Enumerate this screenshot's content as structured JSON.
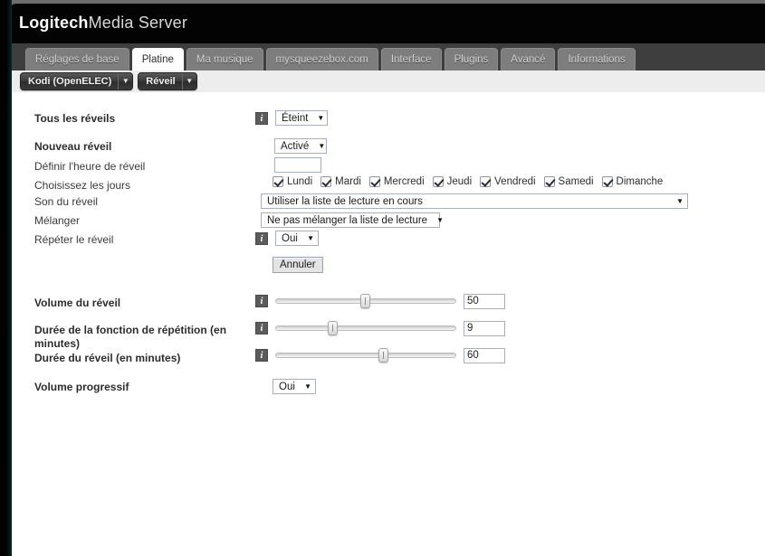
{
  "header": {
    "brand": "Logitech",
    "product": "Media Server"
  },
  "tabs": [
    {
      "label": "Réglages de base",
      "active": false
    },
    {
      "label": "Platine",
      "active": true
    },
    {
      "label": "Ma musique",
      "active": false
    },
    {
      "label": "mysqueezebox.com",
      "active": false
    },
    {
      "label": "Interface",
      "active": false
    },
    {
      "label": "Plugins",
      "active": false
    },
    {
      "label": "Avancé",
      "active": false
    },
    {
      "label": "Informations",
      "active": false
    }
  ],
  "toolbar": {
    "player_button": "Kodi (OpenELEC)",
    "section_button": "Réveil",
    "caret": "▼"
  },
  "form": {
    "all_alarms": {
      "label": "Tous les réveils",
      "info": "i",
      "value": "Éteint"
    },
    "new_alarm": {
      "label": "Nouveau réveil",
      "value": "Activé"
    },
    "alarm_time": {
      "label": "Définir l'heure de réveil",
      "value": "",
      "placeholder": ""
    },
    "days": {
      "label": "Choisissez les jours",
      "items": [
        {
          "label": "Lundi",
          "checked": true
        },
        {
          "label": "Mardi",
          "checked": true
        },
        {
          "label": "Mercredi",
          "checked": true
        },
        {
          "label": "Jeudi",
          "checked": true
        },
        {
          "label": "Vendredi",
          "checked": true
        },
        {
          "label": "Samedi",
          "checked": true
        },
        {
          "label": "Dimanche",
          "checked": true
        }
      ]
    },
    "alarm_sound": {
      "label": "Son du réveil",
      "value": "Utiliser la liste de lecture en cours"
    },
    "shuffle": {
      "label": "Mélanger",
      "value": "Ne pas mélanger la liste de lecture"
    },
    "repeat": {
      "label": "Répéter le réveil",
      "info": "i",
      "value": "Oui"
    },
    "cancel_button": "Annuler",
    "alarm_volume": {
      "label": "Volume du réveil",
      "info": "i",
      "value": "50",
      "percent": 50
    },
    "snooze_duration": {
      "label": "Durée de la fonction de répétition (en minutes)",
      "info": "i",
      "value": "9",
      "percent": 32
    },
    "alarm_duration": {
      "label": "Durée du réveil (en minutes)",
      "info": "i",
      "value": "60",
      "percent": 60
    },
    "fade_in": {
      "label": "Volume progressif",
      "value": "Oui"
    }
  }
}
